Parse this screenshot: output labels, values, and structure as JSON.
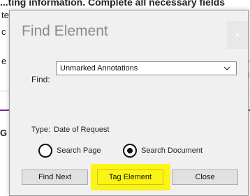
{
  "background": {
    "top_text": "...ting information. Complete all necessary fields",
    "left_fragments": [
      "te",
      "c",
      "e",
      "G"
    ],
    "right_fragments": [
      "e",
      "d"
    ]
  },
  "dialog": {
    "title": "Find Element",
    "close_glyph": "×",
    "find_label": "Find:",
    "find_value": "Unmarked Annotations",
    "type_label": "Type:",
    "type_value": "Date of Request",
    "radios": [
      {
        "label": "Search Page",
        "checked": false
      },
      {
        "label": "Search Document",
        "checked": true
      }
    ],
    "buttons": {
      "find_next": "Find Next",
      "tag_element": "Tag Element",
      "close": "Close"
    }
  },
  "colors": {
    "highlight": "#fbf414",
    "dialog_bg": "#f0f0f0",
    "accent_line": "#7a2a8a"
  }
}
